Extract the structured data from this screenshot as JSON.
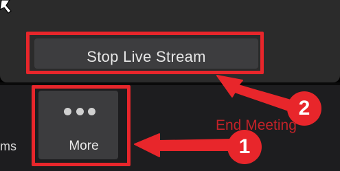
{
  "popup": {
    "menu_item_label": "Stop Live Stream"
  },
  "toolbar": {
    "partial_label": "ms",
    "more_label": "More",
    "end_meeting_label": "End Meeting"
  },
  "annotations": {
    "step1": "1",
    "step2": "2",
    "accent_color": "#e8262b"
  },
  "icons": {
    "cursor": "cursor-icon",
    "more": "more-dots-icon"
  }
}
